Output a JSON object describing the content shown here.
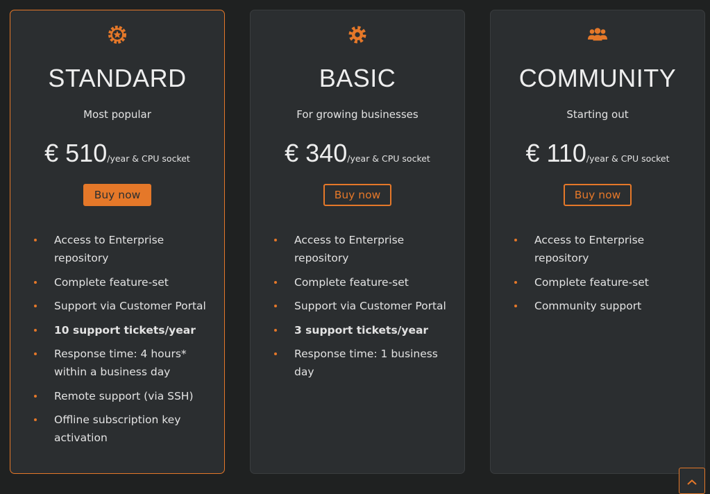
{
  "accent_color": "#e57829",
  "plans": [
    {
      "icon": "badge-star-icon",
      "title": "STANDARD",
      "subtitle": "Most popular",
      "price": "€ 510",
      "price_unit": "/year & CPU socket",
      "button_label": "Buy now",
      "features": [
        "Access to Enterprise repository",
        "Complete feature-set",
        "Support via Customer Portal",
        "10 support tickets/year",
        "Response time: 4 hours* within a business day",
        "Remote support (via SSH)",
        "Offline subscription key activation"
      ]
    },
    {
      "icon": "gear-icon",
      "title": "BASIC",
      "subtitle": "For growing businesses",
      "price": "€ 340",
      "price_unit": "/year & CPU socket",
      "button_label": "Buy now",
      "features": [
        "Access to Enterprise repository",
        "Complete feature-set",
        "Support via Customer Portal",
        "3 support tickets/year",
        "Response time: 1 business day"
      ]
    },
    {
      "icon": "users-icon",
      "title": "COMMUNITY",
      "subtitle": "Starting out",
      "price": "€ 110",
      "price_unit": "/year & CPU socket",
      "button_label": "Buy now",
      "features": [
        "Access to Enterprise repository",
        "Complete feature-set",
        "Community support"
      ]
    }
  ],
  "scroll_top_icon": "chevron-up-icon"
}
